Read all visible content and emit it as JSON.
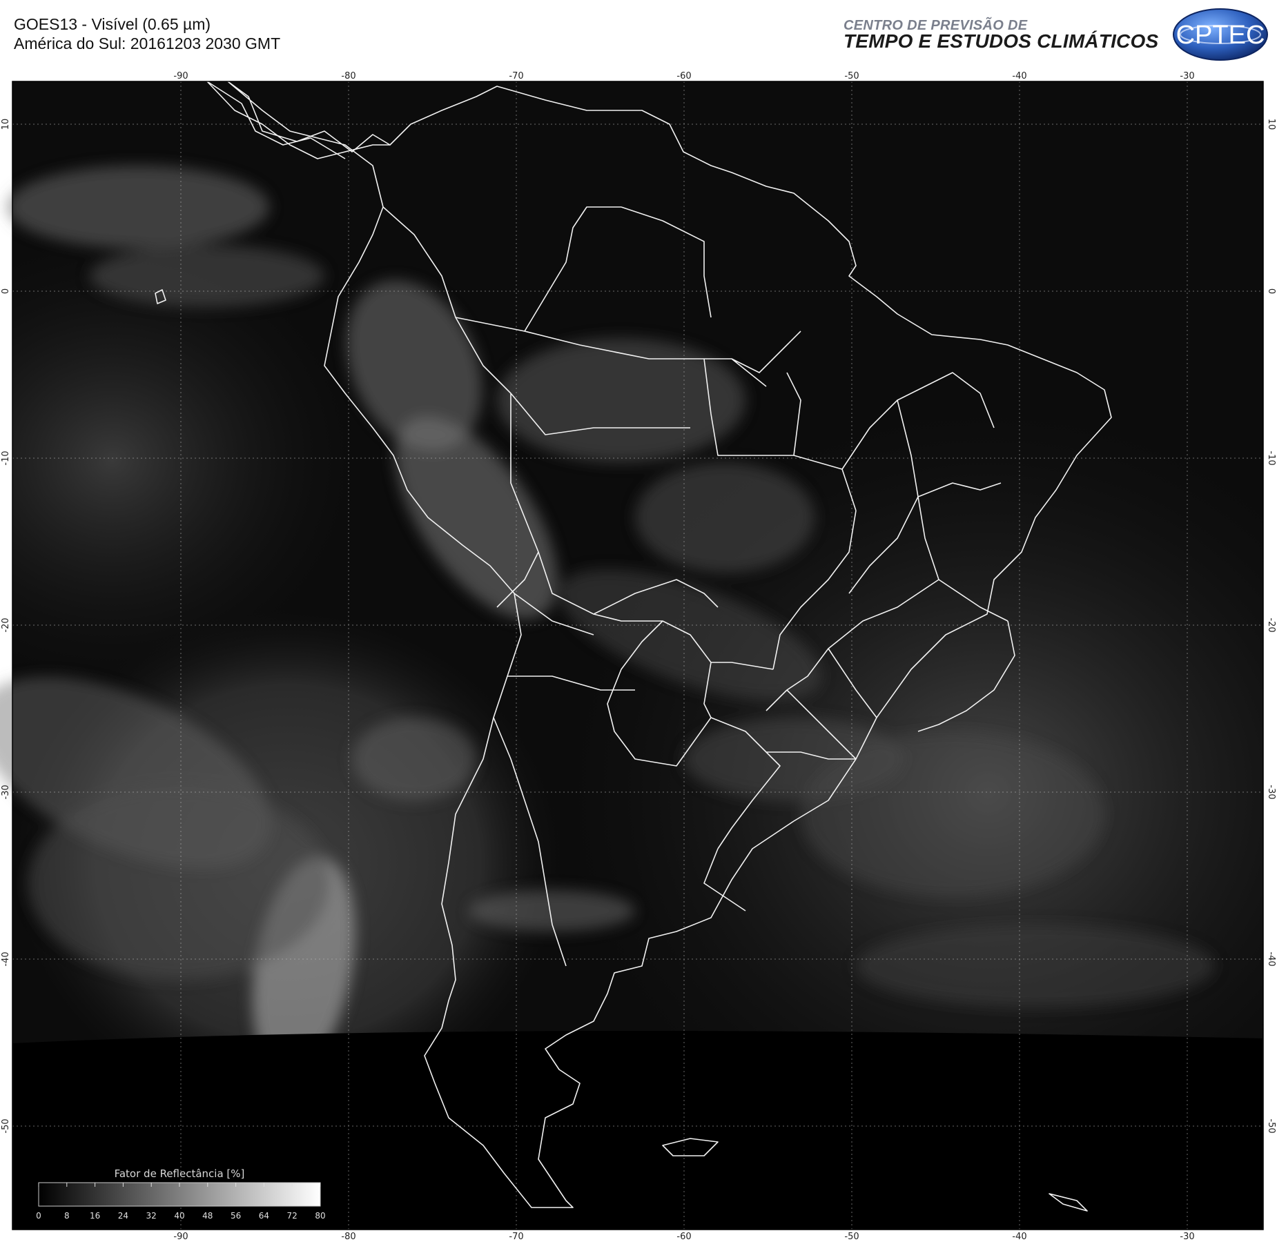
{
  "header": {
    "title_line_1": "GOES13 - Visível (0.65 µm)",
    "title_line_2": "América do Sul: 20161203 2030 GMT",
    "org_line_1": "CENTRO DE PREVISÃO DE",
    "org_line_2": "TEMPO E ESTUDOS CLIMÁTICOS",
    "logo_text": "CPTEC",
    "logo_colors": {
      "outer": "#1d3f8f",
      "inner": "#4a86d8",
      "text": "#ffffff"
    }
  },
  "map": {
    "longitude_labels": [
      "-90",
      "-80",
      "-70",
      "-60",
      "-50",
      "-40",
      "-30"
    ],
    "latitude_labels": [
      "10",
      "0",
      "-10",
      "-20",
      "-30",
      "-40",
      "-50"
    ],
    "longitude_range": [
      -100,
      -26
    ],
    "latitude_range": [
      13,
      -56
    ],
    "grid": true,
    "grid_style": "dotted",
    "border_color": "#ffffff",
    "background_color": "#0a0a0a"
  },
  "legend": {
    "title": "Fator de Reflectância [%]",
    "ticks": [
      "0",
      "8",
      "16",
      "24",
      "32",
      "40",
      "48",
      "56",
      "64",
      "72",
      "80"
    ],
    "placement": "bottom-left"
  }
}
